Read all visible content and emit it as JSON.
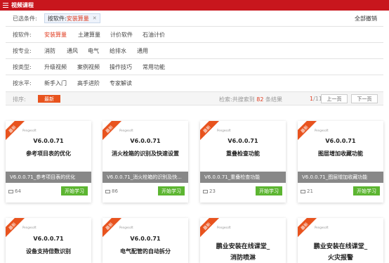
{
  "header": {
    "title": "视频课程"
  },
  "selected": {
    "label": "已选条件:",
    "tag_key": "按软件:",
    "tag_value": "安装算量",
    "clear_all": "全部撤销"
  },
  "filters": [
    {
      "label": "按软件:",
      "options": [
        "安装算量",
        "土建算量",
        "计价软件",
        "石油计价"
      ],
      "active": 0
    },
    {
      "label": "按专业:",
      "options": [
        "消防",
        "通风",
        "电气",
        "给排水",
        "通用"
      ],
      "active": -1
    },
    {
      "label": "按类型:",
      "options": [
        "升级视频",
        "案例视频",
        "操作技巧",
        "常用功能"
      ],
      "active": -1
    },
    {
      "label": "按水平:",
      "options": [
        "新手入门",
        "高手进阶",
        "专家解读"
      ],
      "active": -1
    }
  ],
  "sortbar": {
    "sort_label": "排序:",
    "sort_value": "最新",
    "search_prefix": "检索:共搜索到",
    "search_count": "82",
    "search_suffix": "条结果",
    "page_current": "1",
    "page_total": "/11",
    "prev": "上一页",
    "next": "下一页"
  },
  "cards": [
    {
      "ribbon": "最新",
      "version": "V6.0.0.71",
      "title": "参考项目表的优化",
      "bar": "V6.0.0.71_参考项目表的优化",
      "views": "64",
      "start": "开始学习"
    },
    {
      "ribbon": "最新",
      "version": "V6.0.0.71",
      "title": "消火栓箱的识别及快速设置",
      "bar": "V6.0.0.71_消火栓箱的识别及快...",
      "views": "86",
      "start": "开始学习"
    },
    {
      "ribbon": "最新",
      "version": "V6.0.0.71",
      "title": "重叠检查功能",
      "bar": "V6.0.0.71_重叠检查功能",
      "views": "23",
      "start": "开始学习"
    },
    {
      "ribbon": "最新",
      "version": "V6.0.0.71",
      "title": "图层增加收藏功能",
      "bar": "V6.0.0.71_图层增加收藏功能",
      "views": "21",
      "start": "开始学习"
    },
    {
      "ribbon": "最新",
      "version": "V6.0.0.71",
      "title": "设备支持倍数识别"
    },
    {
      "ribbon": "最新",
      "version": "V6.0.0.71",
      "title": "电气配管的自动拆分"
    },
    {
      "ribbon": "最新",
      "title_line1": "鹏业安装在线课堂_",
      "title_line2": "消防喷淋"
    },
    {
      "ribbon": "最新",
      "title_line1": "鹏业安装在线课堂_",
      "title_line2": "火灾报警"
    }
  ],
  "logo_text": "Pengesoft",
  "colors": {
    "brand": "#c8161d",
    "accent": "#e8531e",
    "start": "#5cb531",
    "bar": "#888888"
  }
}
